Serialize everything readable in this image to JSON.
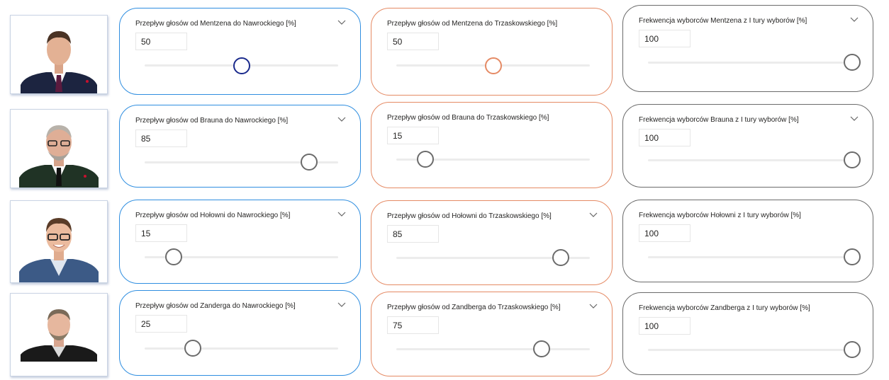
{
  "candidates": [
    {
      "photo_alt": "Mentzen",
      "nawrocki": {
        "title": "Przepływ głosów od Mentzena do Nawrockiego [%]",
        "value": "50",
        "level": 50
      },
      "trzaskowski": {
        "title": "Przepływ głosów od Mentzena do Trzaskowskiego [%]",
        "value": "50",
        "level": 50
      },
      "turnout": {
        "title": "Frekwencja wyborców Mentzena z I tury wyborów [%]",
        "value": "100",
        "level": 100
      }
    },
    {
      "photo_alt": "Braun",
      "nawrocki": {
        "title": "Przepływ głosów od Brauna do Nawrockiego [%]",
        "value": "85",
        "level": 85
      },
      "trzaskowski": {
        "title": "Przepływ głosów od Brauna do Trzaskowskiego [%]",
        "value": "15",
        "level": 15
      },
      "turnout": {
        "title": "Frekwencja wyborców Brauna z I tury wyborów [%]",
        "value": "100",
        "level": 100
      }
    },
    {
      "photo_alt": "Hołownia",
      "nawrocki": {
        "title": "Przepływ głosów od Hołowni do Nawrockiego [%]",
        "value": "15",
        "level": 15
      },
      "trzaskowski": {
        "title": "Przepływ głosów od Hołowni do Trzaskowskiego [%]",
        "value": "85",
        "level": 85
      },
      "turnout": {
        "title": "Frekwencja wyborców Hołowni z I tury wyborów [%]",
        "value": "100",
        "level": 100
      }
    },
    {
      "photo_alt": "Zandberg",
      "nawrocki": {
        "title": "Przepływ głosów od Zanderga do Nawrockiego [%]",
        "value": "25",
        "level": 25
      },
      "trzaskowski": {
        "title": "Przepływ głosów od Zandberga do Trzaskowskiego [%]",
        "value": "75",
        "level": 75
      },
      "turnout": {
        "title": "Frekwencja wyborców Zandberga z I tury wyborów [%]",
        "value": "100",
        "level": 100
      }
    }
  ],
  "colors": {
    "nawrocki_border": "#2f8ee0",
    "trzaskowski_border": "#e58a64",
    "turnout_border": "#6b6b6b",
    "track": "#ececec",
    "thumb": "#6b6b6b",
    "thumb_focused": "#1a2a8c",
    "thumb_accent": "#e58a64"
  },
  "icons": {
    "dropdown": "chevron-down-icon",
    "photo": "candidate-portrait"
  }
}
